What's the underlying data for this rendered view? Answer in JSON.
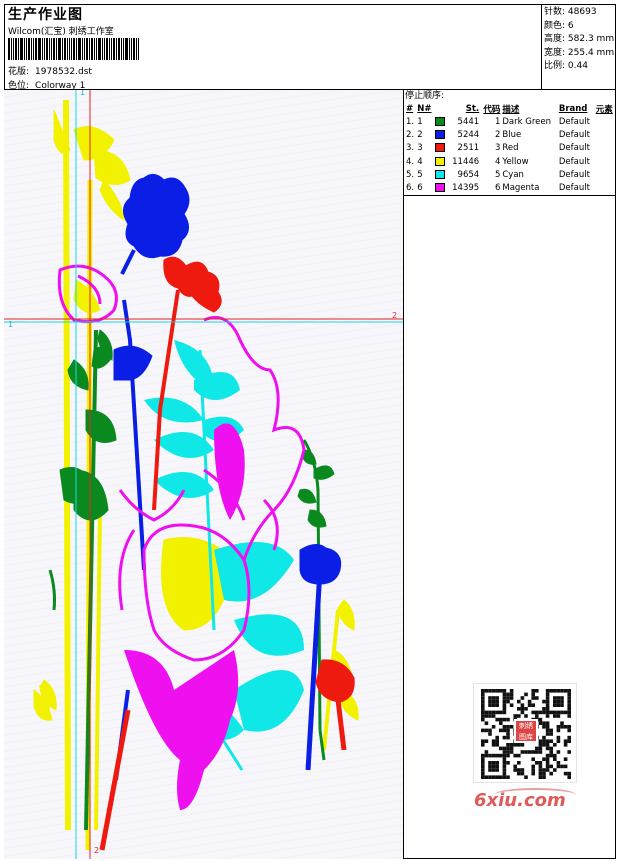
{
  "header": {
    "title": "生产作业图",
    "studio": "Wilcom(汇宝) 刺绣工作室",
    "design_label": "花版:",
    "design_file": "1978532.dst",
    "colorway_label": "色位:",
    "colorway": "Colorway 1"
  },
  "stats": {
    "stitches_label": "针数:",
    "stitches": "48693",
    "colors_label": "颜色:",
    "colors": "6",
    "height_label": "高度:",
    "height": "582.3 mm",
    "width_label": "宽度:",
    "width": "255.4 mm",
    "ratio_label": "比例:",
    "ratio": "0.44"
  },
  "stop_sequence": {
    "title": "停止顺序:",
    "headers": [
      "#",
      "N#",
      "St.",
      "代码",
      "描述",
      "Brand",
      "元素"
    ],
    "rows": [
      {
        "idx": "1.",
        "n": "1",
        "stitches": "5441",
        "code": "1",
        "desc": "Dark Green",
        "brand": "Default",
        "color": "#0a8a1e"
      },
      {
        "idx": "2.",
        "n": "2",
        "stitches": "5244",
        "code": "2",
        "desc": "Blue",
        "brand": "Default",
        "color": "#0a1ee6"
      },
      {
        "idx": "3.",
        "n": "3",
        "stitches": "2511",
        "code": "3",
        "desc": "Red",
        "brand": "Default",
        "color": "#ee1a10"
      },
      {
        "idx": "4.",
        "n": "4",
        "stitches": "11446",
        "code": "4",
        "desc": "Yellow",
        "brand": "Default",
        "color": "#f2f200"
      },
      {
        "idx": "5.",
        "n": "5",
        "stitches": "9654",
        "code": "5",
        "desc": "Cyan",
        "brand": "Default",
        "color": "#10e8e8"
      },
      {
        "idx": "6.",
        "n": "6",
        "stitches": "14395",
        "code": "6",
        "desc": "Magenta",
        "brand": "Default",
        "color": "#ee10ee"
      }
    ]
  },
  "guides": {
    "v1_label": "1",
    "h1_label": "1",
    "v2_label": "2",
    "h2_label": "2"
  },
  "qr": {
    "seal_text": "刺绣图库"
  },
  "watermark": "6xiu.com"
}
